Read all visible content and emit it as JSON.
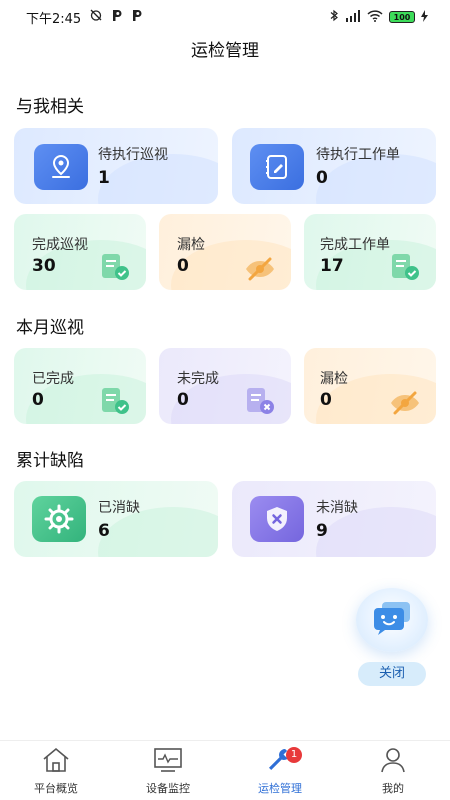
{
  "status_bar": {
    "time": "下午2:45",
    "battery": "100"
  },
  "header": {
    "title": "运检管理"
  },
  "sections": {
    "related": {
      "title": "与我相关",
      "pending_inspection": {
        "label": "待执行巡视",
        "value": "1"
      },
      "pending_workorder": {
        "label": "待执行工作单",
        "value": "0"
      },
      "done_inspection": {
        "label": "完成巡视",
        "value": "30"
      },
      "missed": {
        "label": "漏检",
        "value": "0"
      },
      "done_workorder": {
        "label": "完成工作单",
        "value": "17"
      }
    },
    "monthly": {
      "title": "本月巡视",
      "completed": {
        "label": "已完成",
        "value": "0"
      },
      "uncompleted": {
        "label": "未完成",
        "value": "0"
      },
      "missed": {
        "label": "漏检",
        "value": "0"
      }
    },
    "defects": {
      "title": "累计缺陷",
      "eliminated": {
        "label": "已消缺",
        "value": "6"
      },
      "not_eliminated": {
        "label": "未消缺",
        "value": "9"
      }
    }
  },
  "floating": {
    "close_label": "关闭"
  },
  "tabbar": {
    "tabs": [
      {
        "label": "平台概览",
        "icon": "home-icon"
      },
      {
        "label": "设备监控",
        "icon": "monitor-icon"
      },
      {
        "label": "运检管理",
        "icon": "wrench-icon",
        "badge": "1"
      },
      {
        "label": "我的",
        "icon": "user-icon"
      }
    ]
  },
  "colors": {
    "accent": "#2f6fd6",
    "green": "#3fc28a",
    "orange": "#f3a640",
    "purple": "#8c82e6",
    "badge": "#e8393a"
  }
}
